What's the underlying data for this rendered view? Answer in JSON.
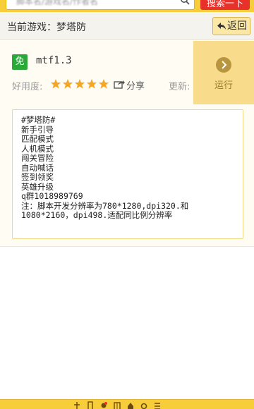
{
  "search": {
    "placeholder": "脚本名/游戏名/作者名",
    "button_label": "搜索一下"
  },
  "game_bar": {
    "current_game_label": "当前游戏：梦塔防",
    "back_label": "返回"
  },
  "script": {
    "badge": "免",
    "name": "mtf1.3",
    "rating_label": "好用度:",
    "stars": 5,
    "share_label": "分享",
    "update_label": "更新:",
    "run_label": "运行",
    "description": "#梦塔防#\n新手引导\n匹配模式\n人机模式\n闯关冒险\n自动喊话\n签到领奖\n英雄升级\nq群1018989769\n注：脚本开发分辨率为780*1280,dpi320.和1080*2160，dpi498.适配同比例分辨率"
  },
  "colors": {
    "header_yellow": "#f7ce3a",
    "search_red": "#e8312b",
    "free_green": "#2aa83a",
    "star_orange": "#f5a623",
    "run_bg": "#f9dc8b"
  },
  "icons": {
    "search": "search-icon",
    "back": "back-arrow-icon",
    "star": "star-icon",
    "share": "share-icon",
    "run": "play-circle-icon"
  }
}
